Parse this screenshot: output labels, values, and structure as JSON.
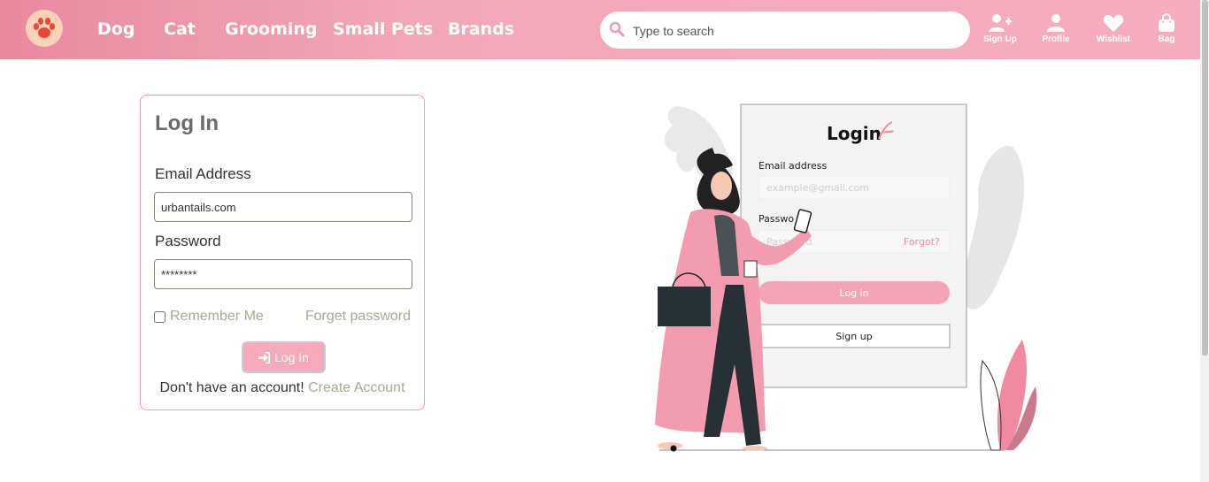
{
  "nav": {
    "links": [
      {
        "label": "Dog"
      },
      {
        "label": "Cat"
      },
      {
        "label": "Grooming"
      },
      {
        "label": "Small Pets"
      },
      {
        "label": "Brands"
      }
    ],
    "search_placeholder": "Type to search",
    "icons": [
      {
        "label": "Sign Up",
        "icon": "add-user-icon"
      },
      {
        "label": "Profile",
        "icon": "user-icon"
      },
      {
        "label": "Wishlist",
        "icon": "heart-icon"
      },
      {
        "label": "Bag",
        "icon": "bag-icon"
      }
    ]
  },
  "login_card": {
    "title": "Log In",
    "email_label": "Email Address",
    "email_value": "urbantails.com",
    "password_label": "Password",
    "password_value": "********",
    "remember_label": "Remember Me",
    "forget_label": "Forget password",
    "button_label": "Log In",
    "no_account_text": "Don't have an account!",
    "create_account_link": "Create Account"
  },
  "illustration": {
    "title": "Login",
    "email_label": "Email address",
    "email_placeholder": "example@gmail.com",
    "password_label": "Passwo",
    "password_placeholder": "Password",
    "forgot_label": "Forgot?",
    "login_button": "Log in",
    "signup_button": "Sign up"
  },
  "colors": {
    "brand_pink": "#f5a9bb",
    "nav_gradient_start": "#e9899f",
    "muted_link": "#a8a896"
  }
}
